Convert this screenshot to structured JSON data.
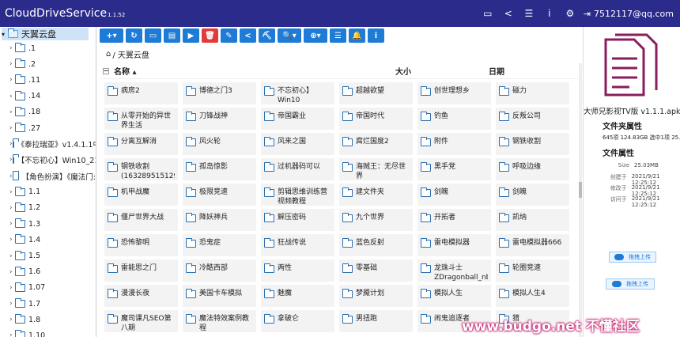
{
  "app": {
    "title": "CloudDriveService",
    "version": "1.1.52"
  },
  "top_icons": [
    {
      "name": "monitor-icon",
      "glyph": "▭"
    },
    {
      "name": "share-icon",
      "glyph": "<"
    },
    {
      "name": "list-icon",
      "glyph": "☰"
    },
    {
      "name": "info-icon",
      "glyph": "i"
    },
    {
      "name": "gear-icon",
      "glyph": "⚙"
    }
  ],
  "user": {
    "label": "7512117@qq.com",
    "icon": "logout-icon"
  },
  "sidebar": {
    "root": "天翼云盘",
    "items": [
      ".1",
      ".2",
      ".11",
      ".14",
      ".18",
      ".27",
      "《泰拉瑞亚》v1.4.1.1中",
      "【不忘初心】Win10_21h",
      "【角色扮演】《魔法门:",
      "1.1",
      "1.2",
      "1.3",
      "1.4",
      "1.5",
      "1.6",
      "1.07",
      "1.7",
      "1.8",
      "1.10"
    ]
  },
  "toolbar": [
    {
      "name": "add-button",
      "glyph": "+▾",
      "wide": true
    },
    {
      "name": "refresh-button",
      "glyph": "↻"
    },
    {
      "name": "view-button",
      "glyph": "▭"
    },
    {
      "name": "file-button",
      "glyph": "▤"
    },
    {
      "name": "play-button",
      "glyph": "▶"
    },
    {
      "name": "delete-button",
      "glyph": "🗑",
      "red": true
    },
    {
      "name": "edit-button",
      "glyph": "✎"
    },
    {
      "name": "share-button",
      "glyph": "<"
    },
    {
      "name": "binoculars-button",
      "glyph": "⛏"
    },
    {
      "name": "search-button",
      "glyph": "🔍▾",
      "wide": true
    },
    {
      "name": "zoom-button",
      "glyph": "⊕▾",
      "wide": true
    },
    {
      "name": "list-view-button",
      "glyph": "☰"
    },
    {
      "name": "bell-button",
      "glyph": "🔔"
    },
    {
      "name": "info-button",
      "glyph": "i"
    }
  ],
  "breadcrumb": "/ 天翼云盘",
  "columns": {
    "name": "名称 ▴",
    "size": "大小",
    "date": "日期"
  },
  "folders": [
    "病房2",
    "博德之门3",
    "不忘初心】Win10",
    "超越欲望",
    "创世理想乡",
    "磁力",
    "从零开始的异世界生活",
    "刀锋战神",
    "帝国霸业",
    "帝国时代",
    "钓鱼",
    "反叛公司",
    "分离互解消",
    "风火轮",
    "风来之国",
    "腐烂国度2",
    "附件",
    "钢铁收割",
    "钢铁收割(1632895151296)",
    "孤岛惊影",
    "过机器码可以",
    "海贼王：无尽世界",
    "黑手党",
    "呼吸边缘",
    "机甲战魔",
    "极限竞速",
    "剪辑思维训练营视频教程",
    "建文件夹",
    "剑魄",
    "剑魄",
    "僵尸世界大战",
    "降妖神兵",
    "解压密码",
    "九个世界",
    "开拓者",
    "凯纳",
    "恐怖黎明",
    "恐鬼症",
    "狂战传说",
    "蓝色反射",
    "雷电模拟器",
    "雷电模拟器666",
    "雷能思之门",
    "冷酷西部",
    "两性",
    "零基础",
    "龙珠斗士ZDragonball_nbsp;",
    "轮圈竞速",
    "漫漫长夜",
    "美国卡车模拟",
    "魅魔",
    "梦魇计划",
    "模拟人生",
    "模拟人生4",
    "魔司课凡SEO第八期",
    "魔法特效案例教程",
    "拿破仑",
    "男扭跑",
    "闹鬼追逐者",
    "猎"
  ],
  "right_panel": {
    "file_name": "大师兄影视TV版 v1.1.1.apk",
    "folder_props_title": "文件夹属性",
    "folder_stats": "645项 124.83GB 选中1项 25.03MB",
    "file_props_title": "文件属性",
    "props": [
      {
        "k": "Size",
        "v": "25.03MB"
      },
      {
        "k": "创建于",
        "v": "2021/9/21 12:25:12"
      },
      {
        "k": "修改于",
        "v": "2021/9/21 12:25:12"
      },
      {
        "k": "访问于",
        "v": "2021/9/21 12:25:12"
      }
    ],
    "upload_btn_1": "拖拽上传",
    "upload_btn_2": "拖拽上传"
  },
  "watermark": "www.budgo.net 不懂社区",
  "colors": {
    "topbar": "#2b2b8c",
    "accent": "#1e7bd6",
    "delete": "#e23b3b"
  }
}
